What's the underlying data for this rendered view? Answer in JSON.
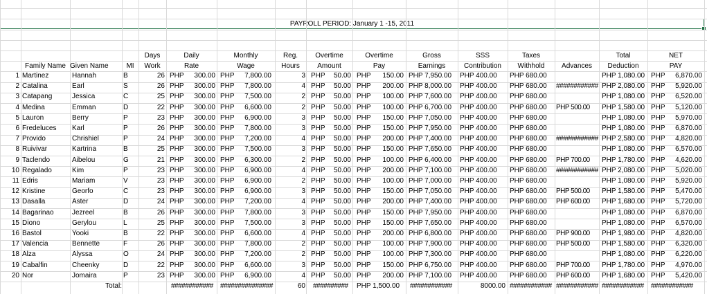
{
  "sheet": {
    "title": "PAYROLL PERIOD: January 1 -15, 2011",
    "headers_top": [
      "",
      "",
      "",
      "Days",
      "Daily",
      "Monthly",
      "Reg.",
      "Overtime",
      "Overtime",
      "Gross",
      "SSS",
      "Taxes",
      "",
      "Total",
      "NET"
    ],
    "headers_bottom": [
      "",
      "Family Name",
      "Given Name",
      "MI",
      "Work",
      "Rate",
      "Wage",
      "Hours",
      "Amount",
      "Pay",
      "Earnings",
      "Contribution",
      "Withhold",
      "Advances",
      "Deduction",
      "PAY"
    ],
    "currency": "PHP",
    "rows": [
      {
        "no": "1",
        "fam": "Martinez",
        "given": "Hannah",
        "mi": "B",
        "days": "26",
        "rate": "300.00",
        "wage": "7,800.00",
        "hrs": "3",
        "otamt": "50.00",
        "otpay": "150.00",
        "gross": "PHP 7,950.00",
        "sss": "PHP 400.00",
        "tax": "PHP 680.00",
        "adv": "",
        "total": "PHP 1,080.00",
        "net": "6,870.00"
      },
      {
        "no": "2",
        "fam": "Catalina",
        "given": "Earl",
        "mi": "S",
        "days": "26",
        "rate": "300.00",
        "wage": "7,800.00",
        "hrs": "4",
        "otamt": "50.00",
        "otpay": "200.00",
        "gross": "PHP 8,000.00",
        "sss": "PHP 400.00",
        "tax": "PHP 680.00",
        "adv": "############",
        "total": "PHP 2,080.00",
        "net": "5,920.00"
      },
      {
        "no": "3",
        "fam": "Catapang",
        "given": "Jessica",
        "mi": "C",
        "days": "25",
        "rate": "300.00",
        "wage": "7,500.00",
        "hrs": "2",
        "otamt": "50.00",
        "otpay": "100.00",
        "gross": "PHP 7,600.00",
        "sss": "PHP 400.00",
        "tax": "PHP 680.00",
        "adv": "",
        "total": "PHP 1,080.00",
        "net": "6,520.00"
      },
      {
        "no": "4",
        "fam": "Medina",
        "given": "Emman",
        "mi": "D",
        "days": "22",
        "rate": "300.00",
        "wage": "6,600.00",
        "hrs": "2",
        "otamt": "50.00",
        "otpay": "100.00",
        "gross": "PHP 6,700.00",
        "sss": "PHP 400.00",
        "tax": "PHP 680.00",
        "adv": "PHP   500.00",
        "total": "PHP 1,580.00",
        "net": "5,120.00"
      },
      {
        "no": "5",
        "fam": "Lauron",
        "given": "Berry",
        "mi": "P",
        "days": "23",
        "rate": "300.00",
        "wage": "6,900.00",
        "hrs": "3",
        "otamt": "50.00",
        "otpay": "150.00",
        "gross": "PHP 7,050.00",
        "sss": "PHP 400.00",
        "tax": "PHP 680.00",
        "adv": "",
        "total": "PHP 1,080.00",
        "net": "5,970.00"
      },
      {
        "no": "6",
        "fam": "Fredeluces",
        "given": "Karl",
        "mi": "P",
        "days": "26",
        "rate": "300.00",
        "wage": "7,800.00",
        "hrs": "3",
        "otamt": "50.00",
        "otpay": "150.00",
        "gross": "PHP 7,950.00",
        "sss": "PHP 400.00",
        "tax": "PHP 680.00",
        "adv": "",
        "total": "PHP 1,080.00",
        "net": "6,870.00"
      },
      {
        "no": "7",
        "fam": "Provido",
        "given": "Chrishiel",
        "mi": "P",
        "days": "24",
        "rate": "300.00",
        "wage": "7,200.00",
        "hrs": "4",
        "otamt": "50.00",
        "otpay": "200.00",
        "gross": "PHP 7,400.00",
        "sss": "PHP 400.00",
        "tax": "PHP 680.00",
        "adv": "############",
        "total": "PHP 2,580.00",
        "net": "4,820.00"
      },
      {
        "no": "8",
        "fam": "Ruivivar",
        "given": "Kartrina",
        "mi": "B",
        "days": "25",
        "rate": "300.00",
        "wage": "7,500.00",
        "hrs": "3",
        "otamt": "50.00",
        "otpay": "150.00",
        "gross": "PHP 7,650.00",
        "sss": "PHP 400.00",
        "tax": "PHP 680.00",
        "adv": "",
        "total": "PHP 1,080.00",
        "net": "6,570.00"
      },
      {
        "no": "9",
        "fam": "Taclendo",
        "given": "Aibelou",
        "mi": "G",
        "days": "21",
        "rate": "300.00",
        "wage": "6,300.00",
        "hrs": "2",
        "otamt": "50.00",
        "otpay": "100.00",
        "gross": "PHP 6,400.00",
        "sss": "PHP 400.00",
        "tax": "PHP 680.00",
        "adv": "PHP   700.00",
        "total": "PHP 1,780.00",
        "net": "4,620.00"
      },
      {
        "no": "10",
        "fam": "Regalado",
        "given": "Kim",
        "mi": "P",
        "days": "23",
        "rate": "300.00",
        "wage": "6,900.00",
        "hrs": "4",
        "otamt": "50.00",
        "otpay": "200.00",
        "gross": "PHP 7,100.00",
        "sss": "PHP 400.00",
        "tax": "PHP 680.00",
        "adv": "############",
        "total": "PHP 2,080.00",
        "net": "5,020.00"
      },
      {
        "no": "11",
        "fam": "Edris",
        "given": "Mariam",
        "mi": "V",
        "days": "23",
        "rate": "300.00",
        "wage": "6,900.00",
        "hrs": "2",
        "otamt": "50.00",
        "otpay": "100.00",
        "gross": "PHP 7,000.00",
        "sss": "PHP 400.00",
        "tax": "PHP 680.00",
        "adv": "",
        "total": "PHP 1,080.00",
        "net": "5,920.00"
      },
      {
        "no": "12",
        "fam": "Kristine",
        "given": "Georfo",
        "mi": "C",
        "days": "23",
        "rate": "300.00",
        "wage": "6,900.00",
        "hrs": "3",
        "otamt": "50.00",
        "otpay": "150.00",
        "gross": "PHP 7,050.00",
        "sss": "PHP 400.00",
        "tax": "PHP 680.00",
        "adv": "PHP   500.00",
        "total": "PHP 1,580.00",
        "net": "5,470.00"
      },
      {
        "no": "13",
        "fam": "Dasalla",
        "given": "Aster",
        "mi": "D",
        "days": "24",
        "rate": "300.00",
        "wage": "7,200.00",
        "hrs": "4",
        "otamt": "50.00",
        "otpay": "200.00",
        "gross": "PHP 7,400.00",
        "sss": "PHP 400.00",
        "tax": "PHP 680.00",
        "adv": "PHP   600.00",
        "total": "PHP 1,680.00",
        "net": "5,720.00"
      },
      {
        "no": "14",
        "fam": "Bagarinao",
        "given": "Jezreel",
        "mi": "B",
        "days": "26",
        "rate": "300.00",
        "wage": "7,800.00",
        "hrs": "3",
        "otamt": "50.00",
        "otpay": "150.00",
        "gross": "PHP 7,950.00",
        "sss": "PHP 400.00",
        "tax": "PHP 680.00",
        "adv": "",
        "total": "PHP 1,080.00",
        "net": "6,870.00"
      },
      {
        "no": "15",
        "fam": "Diono",
        "given": "Gerylou",
        "mi": "L",
        "days": "25",
        "rate": "300.00",
        "wage": "7,500.00",
        "hrs": "3",
        "otamt": "50.00",
        "otpay": "150.00",
        "gross": "PHP 7,650.00",
        "sss": "PHP 400.00",
        "tax": "PHP 680.00",
        "adv": "",
        "total": "PHP 1,080.00",
        "net": "6,570.00"
      },
      {
        "no": "16",
        "fam": "Bastol",
        "given": "Yooki",
        "mi": "B",
        "days": "22",
        "rate": "300.00",
        "wage": "6,600.00",
        "hrs": "4",
        "otamt": "50.00",
        "otpay": "200.00",
        "gross": "PHP 6,800.00",
        "sss": "PHP 400.00",
        "tax": "PHP 680.00",
        "adv": "PHP   900.00",
        "total": "PHP 1,980.00",
        "net": "4,820.00"
      },
      {
        "no": "17",
        "fam": "Valencia",
        "given": "Bennette",
        "mi": "F",
        "days": "26",
        "rate": "300.00",
        "wage": "7,800.00",
        "hrs": "2",
        "otamt": "50.00",
        "otpay": "100.00",
        "gross": "PHP 7,900.00",
        "sss": "PHP 400.00",
        "tax": "PHP 680.00",
        "adv": "PHP   500.00",
        "total": "PHP 1,580.00",
        "net": "6,320.00"
      },
      {
        "no": "18",
        "fam": "Alza",
        "given": "Alyssa",
        "mi": "O",
        "days": "24",
        "rate": "300.00",
        "wage": "7,200.00",
        "hrs": "2",
        "otamt": "50.00",
        "otpay": "100.00",
        "gross": "PHP 7,300.00",
        "sss": "PHP 400.00",
        "tax": "PHP 680.00",
        "adv": "",
        "total": "PHP 1,080.00",
        "net": "6,220.00"
      },
      {
        "no": "19",
        "fam": "Cabalfin",
        "given": "Cheenky",
        "mi": "D",
        "days": "22",
        "rate": "300.00",
        "wage": "6,600.00",
        "hrs": "3",
        "otamt": "50.00",
        "otpay": "150.00",
        "gross": "PHP 6,750.00",
        "sss": "PHP 400.00",
        "tax": "PHP 680.00",
        "adv": "PHP   700.00",
        "total": "PHP 1,780.00",
        "net": "4,970.00"
      },
      {
        "no": "20",
        "fam": "Nor",
        "given": "Jomaira",
        "mi": "P",
        "days": "23",
        "rate": "300.00",
        "wage": "6,900.00",
        "hrs": "4",
        "otamt": "50.00",
        "otpay": "200.00",
        "gross": "PHP 7,100.00",
        "sss": "PHP 400.00",
        "tax": "PHP 680.00",
        "adv": "PHP   600.00",
        "total": "PHP 1,680.00",
        "net": "5,420.00"
      }
    ],
    "totals": {
      "label": "Total:",
      "rate": "############",
      "wage": "###############",
      "hrs": "60",
      "otamt": "##########",
      "otpay": "PHP 1,500.00",
      "gross": "############",
      "sss": "8000.00",
      "tax": "############",
      "adv": "############",
      "total": "############",
      "net": "############"
    }
  }
}
